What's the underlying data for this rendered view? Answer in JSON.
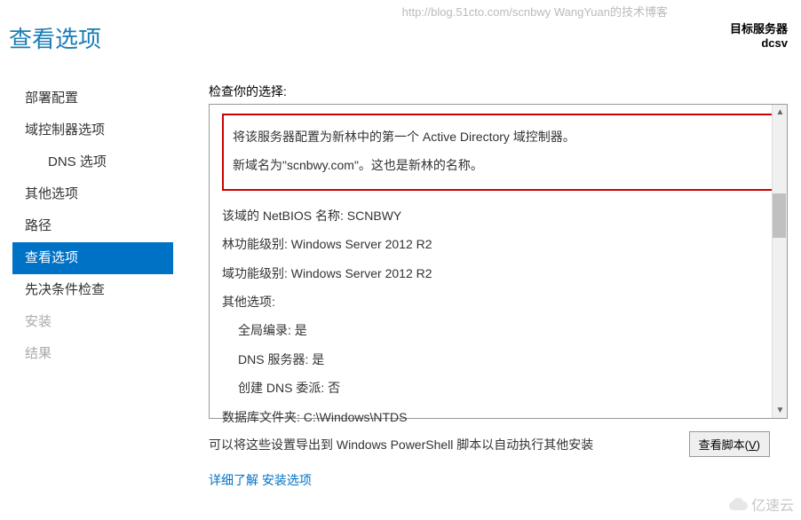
{
  "watermark_url": "http://blog.51cto.com/scnbwy WangYuan的技术博客",
  "header": {
    "target_server_label": "目标服务器",
    "target_server_name": "dcsv"
  },
  "page_title": "查看选项",
  "sidebar": {
    "items": [
      {
        "label": "部署配置",
        "active": false,
        "disabled": false
      },
      {
        "label": "域控制器选项",
        "active": false,
        "disabled": false
      },
      {
        "label": "DNS 选项",
        "active": false,
        "disabled": false,
        "sub": true
      },
      {
        "label": "其他选项",
        "active": false,
        "disabled": false
      },
      {
        "label": "路径",
        "active": false,
        "disabled": false
      },
      {
        "label": "查看选项",
        "active": true,
        "disabled": false
      },
      {
        "label": "先决条件检查",
        "active": false,
        "disabled": false
      },
      {
        "label": "安装",
        "active": false,
        "disabled": true
      },
      {
        "label": "结果",
        "active": false,
        "disabled": true
      }
    ]
  },
  "content": {
    "review_label": "检查你的选择:",
    "highlighted": [
      "将该服务器配置为新林中的第一个 Active Directory 域控制器。",
      "新域名为\"scnbwy.com\"。这也是新林的名称。"
    ],
    "lines": [
      {
        "text": "该域的 NetBIOS 名称: SCNBWY",
        "indent": false
      },
      {
        "text": "林功能级别: Windows Server 2012 R2",
        "indent": false
      },
      {
        "text": "域功能级别: Windows Server 2012 R2",
        "indent": false
      },
      {
        "text": "其他选项:",
        "indent": false
      },
      {
        "text": "全局编录: 是",
        "indent": true
      },
      {
        "text": "DNS 服务器: 是",
        "indent": true
      },
      {
        "text": "创建 DNS 委派: 否",
        "indent": true
      },
      {
        "text": "数据库文件夹: C:\\Windows\\NTDS",
        "indent": false
      }
    ],
    "export_text": "可以将这些设置导出到 Windows PowerShell 脚本以自动执行其他安装",
    "view_script_btn": "查看脚本",
    "view_script_key": "V",
    "link_label": "详细了解",
    "link_action": "安装选项"
  },
  "footer_watermark": "亿速云"
}
